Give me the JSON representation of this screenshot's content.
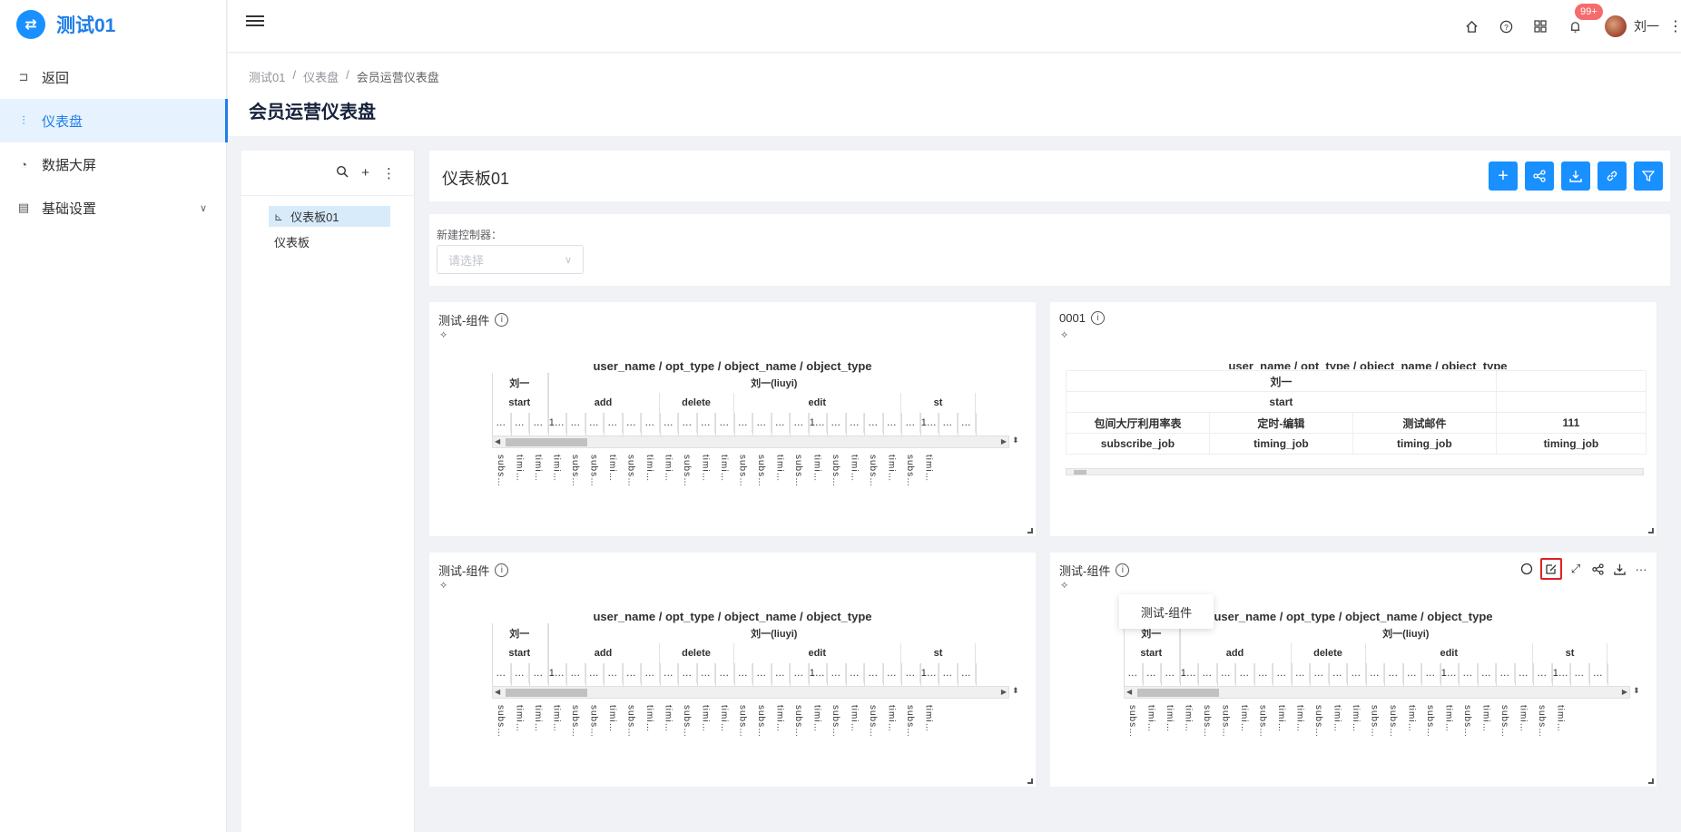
{
  "app": {
    "name": "测试01"
  },
  "sidebar": {
    "items": [
      {
        "label": "返回",
        "icon": "back-icon"
      },
      {
        "label": "仪表盘",
        "icon": "dashboard-icon",
        "active": true
      },
      {
        "label": "数据大屏",
        "icon": "pie-chart-icon"
      },
      {
        "label": "基础设置",
        "icon": "settings-icon",
        "expandable": true
      }
    ]
  },
  "header": {
    "notifications_badge": "99+",
    "user_name": "刘一",
    "icons": [
      "home-icon",
      "help-icon",
      "apps-grid-icon",
      "bell-icon"
    ]
  },
  "breadcrumb": [
    "测试01",
    "仪表盘",
    "会员运营仪表盘"
  ],
  "page_title": "会员运营仪表盘",
  "tree": {
    "nodes": [
      {
        "label": "仪表板01",
        "selected": true
      },
      {
        "label": "仪表板",
        "selected": false
      }
    ]
  },
  "dashboard": {
    "title": "仪表板01",
    "actions": [
      "add-icon",
      "share-icon",
      "download-icon",
      "link-icon",
      "filter-icon"
    ]
  },
  "filter": {
    "label": "新建控制器：",
    "placeholder": "请选择"
  },
  "accent_color": "#1890ff",
  "pivot_common": {
    "header_title": "user_name / opt_type / object_name / object_type",
    "row1": [
      "刘一",
      "刘一(liuyi)"
    ],
    "row2": [
      "start",
      "add",
      "delete",
      "edit",
      "st"
    ],
    "row3": [
      "…",
      "…",
      "…",
      "1…",
      "…",
      "…",
      "…",
      "…",
      "…",
      "…",
      "…",
      "…",
      "…",
      "…",
      "…",
      "…",
      "…",
      "1…",
      "…",
      "…",
      "…",
      "…",
      "…",
      "1…",
      "…",
      "…"
    ],
    "row4": [
      "subs…",
      "timi…",
      "timi…",
      "timi…",
      "subs…",
      "subs…",
      "timi…",
      "subs…",
      "timi…",
      "timi…",
      "subs…",
      "timi…",
      "timi…",
      "subs…",
      "subs…",
      "timi…",
      "subs…",
      "timi…",
      "subs…",
      "timi…",
      "subs…",
      "timi…",
      "subs…",
      "timi…"
    ]
  },
  "cards": [
    {
      "title": "测试-组件",
      "type": "pivot"
    },
    {
      "title": "0001",
      "type": "table",
      "header_title": "user_name / opt_type / object_name / object_type",
      "rows": [
        [
          "刘一"
        ],
        [
          "start"
        ],
        [
          "包间大厅利用率表",
          "定时-编辑",
          "测试邮件",
          "111"
        ],
        [
          "subscribe_job",
          "timing_job",
          "timing_job",
          "timing_job"
        ]
      ]
    },
    {
      "title": "测试-组件",
      "type": "pivot"
    },
    {
      "title": "测试-组件",
      "type": "pivot",
      "tools": [
        "loading-circle-icon",
        "edit-icon",
        "fullscreen-icon",
        "share-icon",
        "download-icon",
        "more-icon"
      ]
    }
  ],
  "tooltip": "测试-组件"
}
